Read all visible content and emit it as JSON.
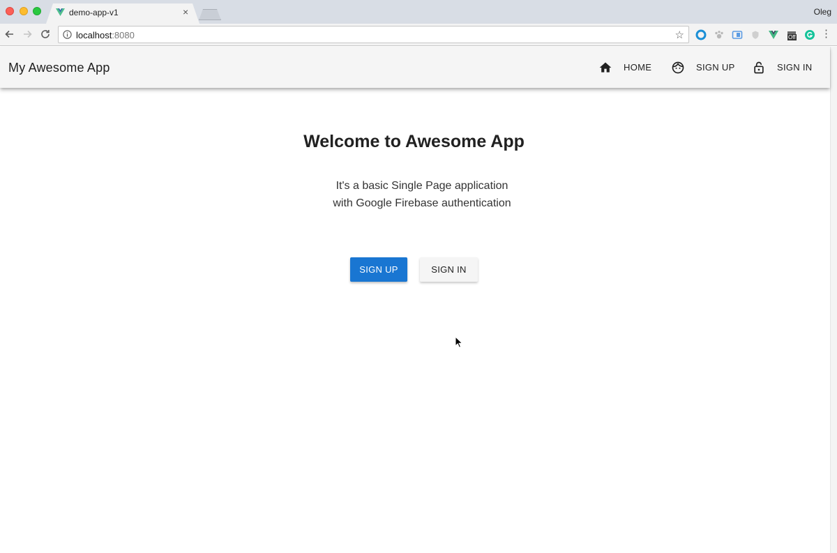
{
  "browser": {
    "tab_title": "demo-app-v1",
    "tab_close": "×",
    "url_host": "localhost",
    "url_port": ":8080",
    "profile_name": "Oleg",
    "ext_off_badge": "Off"
  },
  "app": {
    "title": "My Awesome App",
    "nav": {
      "home": "HOME",
      "signup": "SIGN UP",
      "signin": "SIGN IN"
    }
  },
  "main": {
    "heading": "Welcome to Awesome App",
    "subtitle_line1": "It's a basic Single Page application",
    "subtitle_line2": "with Google Firebase authentication",
    "signup_button": "SIGN UP",
    "signin_button": "SIGN IN"
  },
  "colors": {
    "primary": "#1976d2",
    "appbar": "#f5f5f5",
    "text": "#212121"
  },
  "icons": {
    "home": "home-icon",
    "signup": "face-icon",
    "signin": "lock-open-icon"
  }
}
